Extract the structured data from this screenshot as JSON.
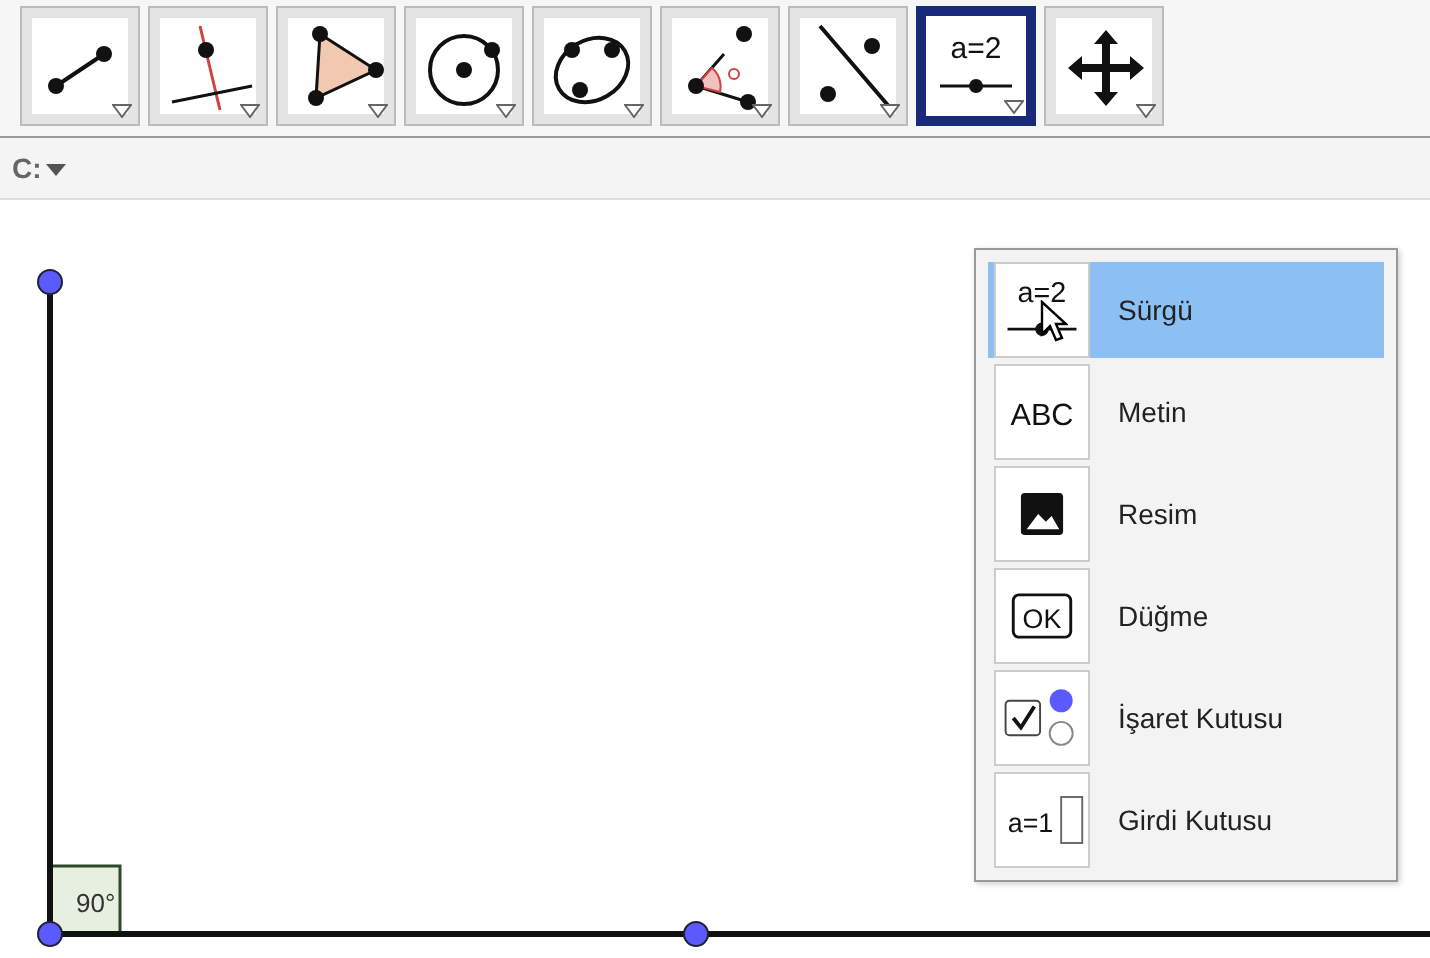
{
  "toolbar": {
    "tools": [
      {
        "kind": "segment",
        "selected": false
      },
      {
        "kind": "perpendicular",
        "selected": false
      },
      {
        "kind": "polygon",
        "selected": false
      },
      {
        "kind": "circle",
        "selected": false
      },
      {
        "kind": "conic",
        "selected": false
      },
      {
        "kind": "angle",
        "selected": false
      },
      {
        "kind": "reflect",
        "selected": false
      },
      {
        "kind": "slider",
        "icon_text": "a=2",
        "selected": true
      },
      {
        "kind": "move",
        "selected": false
      }
    ]
  },
  "style_bar": {
    "label": "C:"
  },
  "menu": {
    "items": [
      {
        "kind": "slider",
        "icon_text": "a=2",
        "label": "Sürgü",
        "selected": true
      },
      {
        "kind": "text",
        "icon_text": "ABC",
        "label": "Metin",
        "selected": false
      },
      {
        "kind": "image",
        "label": "Resim",
        "selected": false
      },
      {
        "kind": "button",
        "icon_text": "OK",
        "label": "Düğme",
        "selected": false
      },
      {
        "kind": "checkbox",
        "label": "İşaret Kutusu",
        "selected": false
      },
      {
        "kind": "input",
        "icon_text": "a=1",
        "label": "Girdi Kutusu",
        "selected": false
      }
    ]
  },
  "canvas": {
    "angle_label": "90°"
  }
}
